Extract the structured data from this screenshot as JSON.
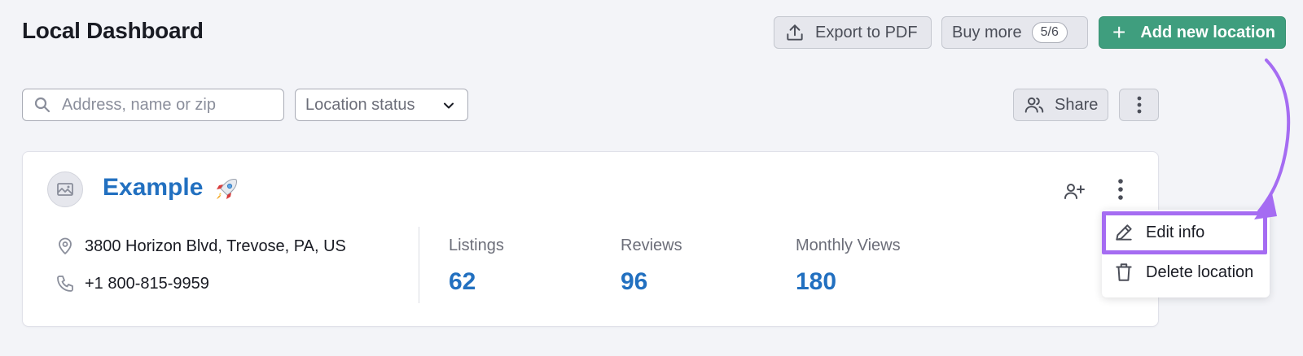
{
  "header": {
    "title": "Local Dashboard",
    "export_label": "Export to PDF",
    "buy_more_label": "Buy more",
    "buy_more_badge": "5/6",
    "add_location_label": "Add new location"
  },
  "filters": {
    "search_placeholder": "Address, name or zip",
    "status_select_label": "Location status",
    "share_label": "Share"
  },
  "location": {
    "name": "Example",
    "address": "3800 Horizon Blvd, Trevose, PA, US",
    "phone": "+1 800-815-9959",
    "stats": [
      {
        "label": "Listings",
        "value": "62"
      },
      {
        "label": "Reviews",
        "value": "96"
      },
      {
        "label": "Monthly Views",
        "value": "180"
      }
    ]
  },
  "menu": {
    "items": [
      {
        "label": "Edit info",
        "icon": "pencil-icon"
      },
      {
        "label": "Delete location",
        "icon": "trash-icon"
      }
    ]
  },
  "colors": {
    "primary": "#3f9e7e",
    "link": "#2270c0",
    "highlight": "#a56cf2"
  }
}
